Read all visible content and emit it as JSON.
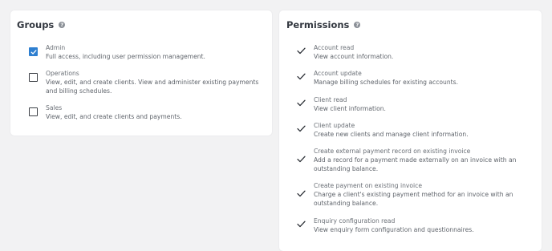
{
  "groups": {
    "title": "Groups",
    "help_icon": "help-icon",
    "items": [
      {
        "name": "Admin",
        "description": "Full access, including user permission management.",
        "checked": true
      },
      {
        "name": "Operations",
        "description": "View, edit, and create clients. View and administer existing payments and billing schedules.",
        "checked": false
      },
      {
        "name": "Sales",
        "description": "View, edit, and create clients and payments.",
        "checked": false
      }
    ]
  },
  "permissions": {
    "title": "Permissions",
    "help_icon": "help-icon",
    "items": [
      {
        "name": "Account read",
        "description": "View account information."
      },
      {
        "name": "Account update",
        "description": "Manage billing schedules for existing accounts."
      },
      {
        "name": "Client read",
        "description": "View client information."
      },
      {
        "name": "Client update",
        "description": "Create new clients and manage client information."
      },
      {
        "name": "Create external payment record on existing invoice",
        "description": "Add a record for a payment made externally on an invoice with an outstanding balance."
      },
      {
        "name": "Create payment on existing invoice",
        "description": "Charge a client's existing payment method for an invoice with an outstanding balance."
      },
      {
        "name": "Enquiry configuration read",
        "description": "View enquiry form configuration and questionnaires."
      }
    ]
  },
  "colors": {
    "checkbox_checked": "#2e7fd0",
    "page_background": "#f2f2f3",
    "panel_background": "#ffffff"
  }
}
